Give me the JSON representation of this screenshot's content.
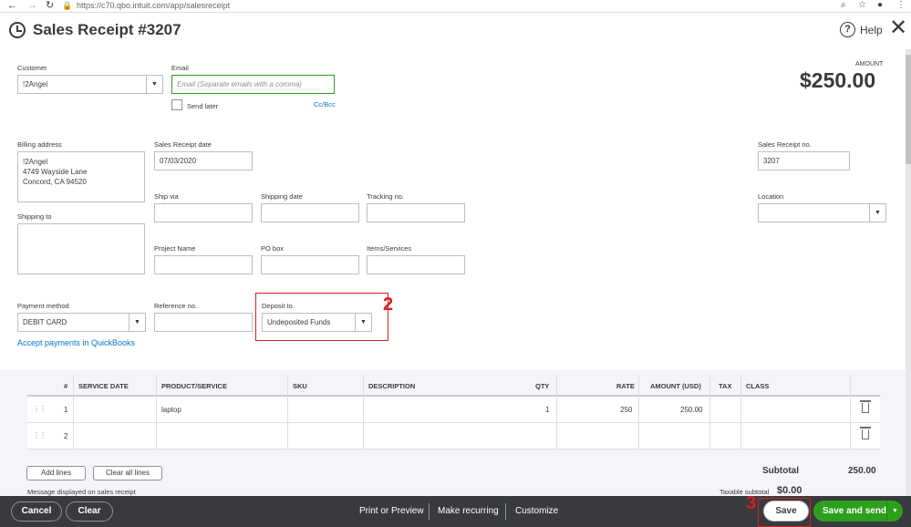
{
  "browser": {
    "url": "https://c70.qbo.intuit.com/app/salesreceipt"
  },
  "header": {
    "title": "Sales Receipt #3207",
    "help_label": "Help"
  },
  "form": {
    "customer_label": "Customer",
    "customer_value": "!2Angel",
    "email_label": "Email",
    "email_placeholder": "Email (Separate emails with a comma)",
    "send_later_label": "Send later",
    "cc_bcc_label": "Cc/Bcc",
    "amount_label": "AMOUNT",
    "amount_value": "$250.00",
    "billing_address_label": "Billing address",
    "billing_address_lines": [
      "!2Angel",
      "4749  Wayside Lane",
      "Concord, CA  94520"
    ],
    "sales_receipt_date_label": "Sales Receipt date",
    "sales_receipt_date_value": "07/03/2020",
    "sales_receipt_no_label": "Sales Receipt no.",
    "sales_receipt_no_value": "3207",
    "ship_via_label": "Ship via",
    "shipping_date_label": "Shipping date",
    "tracking_no_label": "Tracking no.",
    "location_label": "Location",
    "shipping_to_label": "Shipping to",
    "project_name_label": "Project Name",
    "po_box_label": "PO box",
    "items_services_label": "Items/Services",
    "payment_method_label": "Payment method",
    "payment_method_value": "DEBIT CARD",
    "reference_no_label": "Reference no.",
    "deposit_to_label": "Deposit to",
    "deposit_to_value": "Undeposited Funds",
    "accept_payments_link": "Accept payments in QuickBooks"
  },
  "annotations": {
    "deposit_marker": "2",
    "save_marker": "3"
  },
  "table": {
    "headers": [
      "#",
      "SERVICE DATE",
      "PRODUCT/SERVICE",
      "SKU",
      "DESCRIPTION",
      "QTY",
      "RATE",
      "AMOUNT (USD)",
      "TAX",
      "CLASS"
    ],
    "rows": [
      {
        "num": "1",
        "service_date": "",
        "product": "laptop",
        "sku": "",
        "description": "",
        "qty": "1",
        "rate": "250",
        "amount": "250.00",
        "tax": "",
        "class": ""
      },
      {
        "num": "2",
        "service_date": "",
        "product": "",
        "sku": "",
        "description": "",
        "qty": "",
        "rate": "",
        "amount": "",
        "tax": "",
        "class": ""
      }
    ],
    "add_lines_label": "Add lines",
    "clear_lines_label": "Clear all lines",
    "subtotal_label": "Subtotal",
    "subtotal_value": "250.00",
    "message_label": "Message displayed on sales receipt",
    "taxable_subtotal_label": "Taxable subtotal",
    "taxable_subtotal_value": "$0.00"
  },
  "footer": {
    "cancel_label": "Cancel",
    "clear_label": "Clear",
    "print_preview_label": "Print or Preview",
    "make_recurring_label": "Make recurring",
    "customize_label": "Customize",
    "save_label": "Save",
    "save_send_label": "Save and send"
  },
  "colors": {
    "primary_green": "#2ca01c",
    "link_blue": "#0077c5",
    "annotation_red": "#d62020",
    "footer_bg": "#393a3d"
  }
}
